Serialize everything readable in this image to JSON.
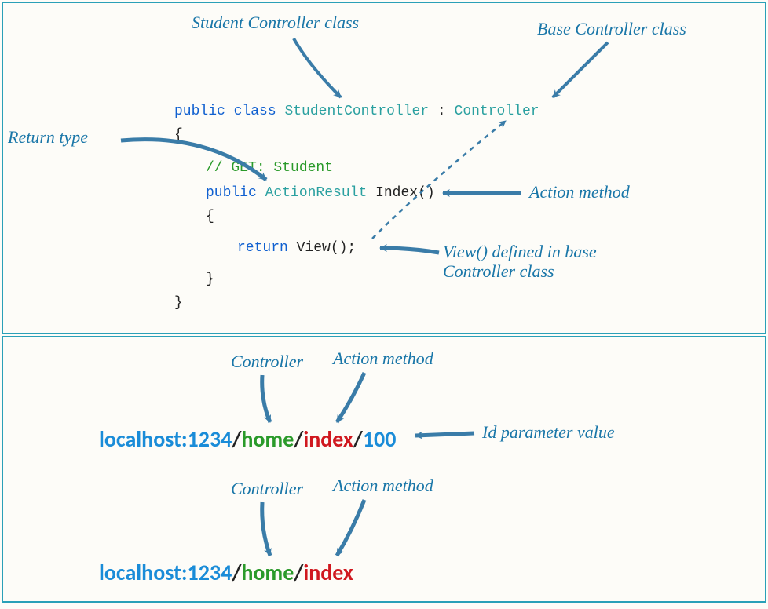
{
  "annotations": {
    "studentController": "Student Controller class",
    "baseController": "Base Controller class",
    "returnType": "Return type",
    "actionMethod": "Action method",
    "viewDefined1": "View() defined in base",
    "viewDefined2": "Controller class",
    "controllerLabel": "Controller",
    "actionMethodLabel": "Action method",
    "idParam": "Id parameter value",
    "controllerLabel2": "Controller",
    "actionMethodLabel2": "Action method"
  },
  "code": {
    "line1_kw1": "public",
    "line1_kw2": "class",
    "line1_type1": "StudentController",
    "line1_colon": ":",
    "line1_type2": "Controller",
    "brace_open": "{",
    "comment": "// GET: Student",
    "line2_kw": "public",
    "line2_type": "ActionResult",
    "line2_name": "Index()",
    "brace_open2": "{",
    "return_kw": "return",
    "return_call": "View();",
    "brace_close2": "}",
    "brace_close": "}"
  },
  "url1": {
    "host": "localhost:1234",
    "slash": "/",
    "home": "home",
    "index": "index",
    "id": "100"
  },
  "url2": {
    "host": "localhost:1234",
    "slash": "/",
    "home": "home",
    "index": "index"
  }
}
